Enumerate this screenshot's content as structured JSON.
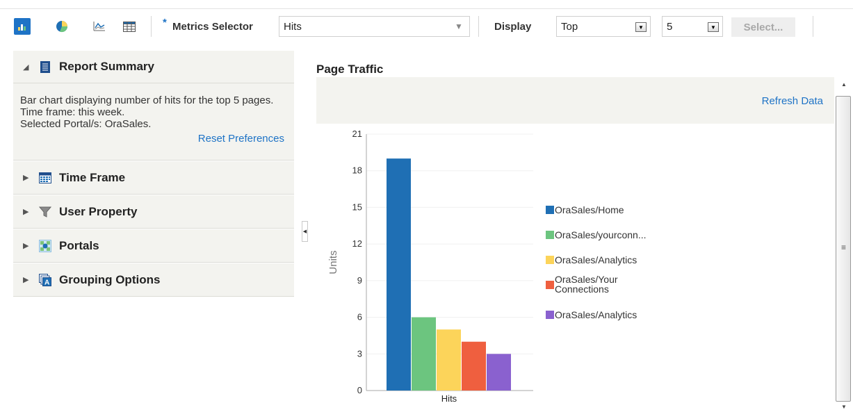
{
  "toolbar": {
    "views": [
      {
        "name": "bar-chart-view",
        "active": true
      },
      {
        "name": "pie-chart-view",
        "active": false
      },
      {
        "name": "line-chart-view",
        "active": false
      },
      {
        "name": "table-view",
        "active": false
      }
    ],
    "required_mark": "*",
    "metrics_label": "Metrics Selector",
    "metrics_value": "Hits",
    "display_label": "Display",
    "display_value": "Top",
    "count_value": "5",
    "select_label": "Select..."
  },
  "left_panel": {
    "summary": {
      "title": "Report Summary",
      "lines": [
        "Bar chart displaying number of hits for the top 5 pages.",
        "Time frame: this week.",
        "Selected Portal/s: OraSales."
      ],
      "reset_label": "Reset Preferences"
    },
    "sections": [
      {
        "title": "Time Frame",
        "icon": "calendar-icon"
      },
      {
        "title": "User Property",
        "icon": "filter-icon"
      },
      {
        "title": "Portals",
        "icon": "portal-icon"
      },
      {
        "title": "Grouping Options",
        "icon": "grouping-icon"
      }
    ]
  },
  "main": {
    "title": "Page Traffic",
    "refresh_label": "Refresh Data"
  },
  "chart_data": {
    "type": "bar",
    "categories": [
      "Hits"
    ],
    "series": [
      {
        "name": "OraSales/Home",
        "values": [
          19
        ],
        "color": "#1f6fb4"
      },
      {
        "name": "OraSales/yourconn...",
        "values": [
          6
        ],
        "color": "#6cc57f"
      },
      {
        "name": "OraSales/Analytics",
        "values": [
          5
        ],
        "color": "#fcd45a"
      },
      {
        "name": "OraSales/Your Connections",
        "values": [
          4
        ],
        "color": "#ef5f3f"
      },
      {
        "name": "OraSales/Analytics",
        "values": [
          3
        ],
        "color": "#8a61cf"
      }
    ],
    "ylabel": "Units",
    "xlabel": "",
    "ylim": [
      0,
      21
    ],
    "yticks": [
      0,
      3,
      6,
      9,
      12,
      15,
      18,
      21
    ],
    "grid": true,
    "legend": "right"
  }
}
